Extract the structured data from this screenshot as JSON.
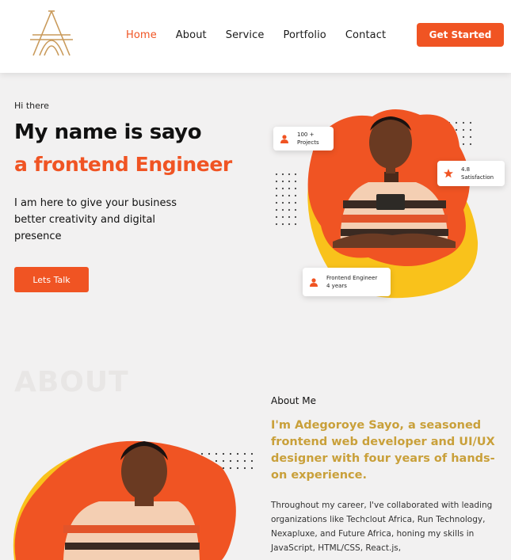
{
  "nav": {
    "links": [
      "Home",
      "About",
      "Service",
      "Portfolio",
      "Contact"
    ],
    "active": "Home",
    "cta_label": "Get Started"
  },
  "hero": {
    "greeting": "Hi there",
    "title": "My name is sayo",
    "subtitle": "a frontend Engineer",
    "lead": "I am here to give your business better creativity and digital presence",
    "button_label": "Lets Talk",
    "badges": {
      "projects": {
        "line1": "100 +",
        "line2": "Projects",
        "icon": "user-icon"
      },
      "satisfaction": {
        "line1": "4.8",
        "line2": "Satisfaction",
        "icon": "star-icon"
      },
      "role": {
        "line1": "Frontend Engineer",
        "line2": "4 years",
        "icon": "user-icon"
      }
    }
  },
  "about": {
    "watermark": "ABOUT",
    "label": "About Me",
    "headline": "I'm Adegoroye Sayo, a seasoned frontend web developer and UI/UX designer with four years of hands-on experience.",
    "body": "Throughout my career, I've collaborated with leading organizations like Techclout Africa, Run Technology, Nexapluxe, and Future Africa, honing my skills in JavaScript, HTML/CSS, React.js,"
  },
  "colors": {
    "accent": "#f05423",
    "gold": "#c9a03a",
    "yellow": "#f9c21b",
    "background": "#f2f1f1"
  }
}
